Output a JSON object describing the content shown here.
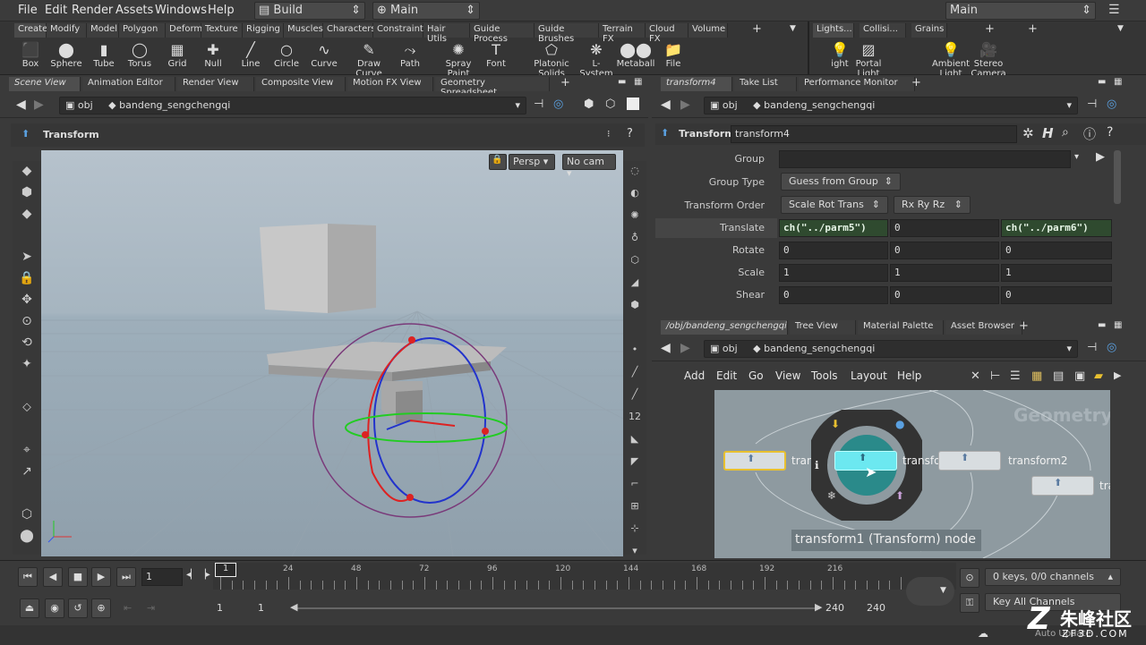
{
  "menubar": {
    "items": [
      "File",
      "Edit",
      "Render",
      "Assets",
      "Windows",
      "Help"
    ],
    "desktop_left": "Build",
    "desktop_mid": "Main",
    "desktop_right": "Main"
  },
  "shelf": {
    "tabs": [
      "Create",
      "Modify",
      "Model",
      "Polygon",
      "Deform",
      "Texture",
      "Rigging",
      "Muscles",
      "Characters",
      "Constraints",
      "Hair Utils",
      "Guide Process",
      "Guide Brushes",
      "Terrain FX",
      "Cloud FX",
      "Volume"
    ],
    "tools": [
      "Box",
      "Sphere",
      "Tube",
      "Torus",
      "Grid",
      "Null",
      "Line",
      "Circle",
      "Curve",
      "Draw Curve",
      "Path",
      "Spray Paint",
      "Font",
      "Platonic Solids",
      "L-System",
      "Metaball",
      "File"
    ],
    "right_tabs": [
      "Lights...",
      "Collisi...",
      "Grains"
    ],
    "right_tools": [
      "ight",
      "Portal Light",
      "Ambient Light",
      "Stereo Camera"
    ]
  },
  "left_pane": {
    "tabs": [
      "Scene View",
      "Animation Editor",
      "Render View",
      "Composite View",
      "Motion FX View",
      "Geometry Spreadsheet"
    ],
    "path_obj": "obj",
    "path_node": "bandeng_sengchengqi",
    "header_title": "Transform",
    "persp": "Persp",
    "cam": "No cam"
  },
  "param_pane": {
    "tabs": [
      "transform4",
      "Take List",
      "Performance Monitor"
    ],
    "path_obj": "obj",
    "path_node": "bandeng_sengchengqi",
    "type_label": "Transform",
    "node_name": "transform4",
    "params": {
      "group_label": "Group",
      "group_value": "",
      "group_type_label": "Group Type",
      "group_type_value": "Guess from Group",
      "order_label": "Transform Order",
      "order_value": "Scale Rot Trans",
      "rot_order_value": "Rx Ry Rz",
      "translate_label": "Translate",
      "translate": [
        "ch(\"../parm5\")",
        "0",
        "ch(\"../parm6\")"
      ],
      "rotate_label": "Rotate",
      "rotate": [
        "0",
        "0",
        "0"
      ],
      "scale_label": "Scale",
      "scale": [
        "1",
        "1",
        "1"
      ],
      "shear_label": "Shear",
      "shear": [
        "0",
        "0",
        "0"
      ]
    }
  },
  "network_pane": {
    "tabs": [
      "/obj/bandeng_sengchengqi",
      "Tree View",
      "Material Palette",
      "Asset Browser"
    ],
    "path_obj": "obj",
    "path_node": "bandeng_sengchengqi",
    "menu": [
      "Add",
      "Edit",
      "Go",
      "View",
      "Tools",
      "Layout",
      "Help"
    ],
    "watermark": "Geometry",
    "nodes": [
      "transf",
      "transfo",
      "transform2",
      "trans"
    ],
    "tooltip": "transform1 (Transform) node"
  },
  "timeline": {
    "frame": "1",
    "ticks": [
      "1",
      "24",
      "48",
      "72",
      "96",
      "120",
      "144",
      "168",
      "192",
      "216"
    ],
    "start": "1",
    "start2": "1",
    "end": "240",
    "end2": "240",
    "keys_info": "0 keys, 0/0 channels",
    "key_all": "Key All Channels",
    "auto_update": "Auto Update"
  },
  "brand": {
    "logo_text": "朱峰社区",
    "logo_url_text": "ZF3D.COM"
  }
}
